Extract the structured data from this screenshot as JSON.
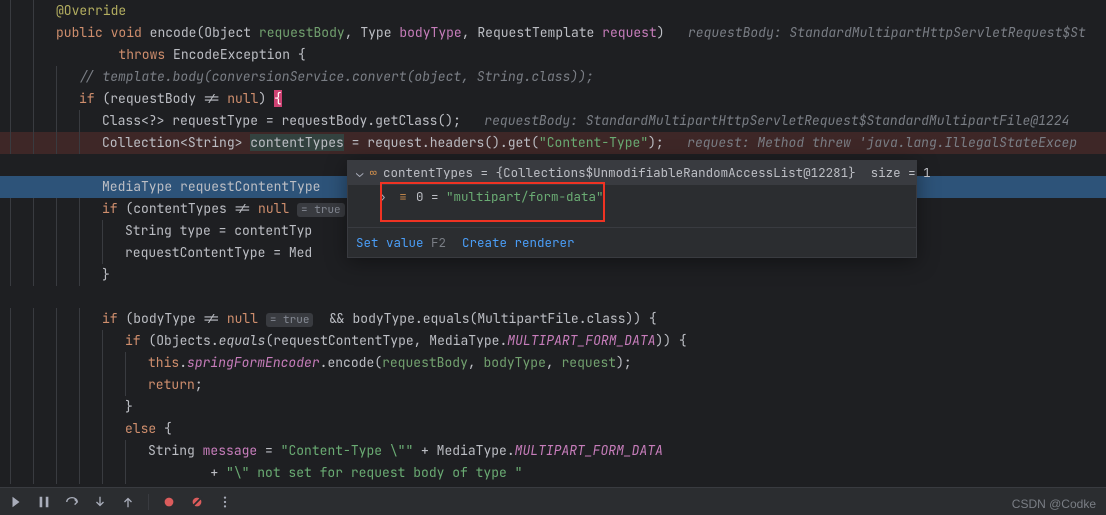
{
  "code": {
    "override": "@Override",
    "public": "public",
    "void": "void",
    "encode": "encode",
    "object_t": "Object",
    "requestBody": "requestBody",
    "type_t": "Type",
    "bodyType": "bodyType",
    "reqtemplate": "RequestTemplate",
    "request": "request",
    "inline1": "requestBody: StandardMultipartHttpServletRequest$St",
    "throws": "throws",
    "exc": "EncodeException",
    "cmt_line": "// template.body(conversionService.convert(object, String.class));",
    "if": "if",
    "null": "null",
    "class_kw": "Class",
    "wild": "<?>",
    "requestType": "requestType",
    "getClass": "getClass",
    "inline2": "requestBody: StandardMultipartHttpServletRequest$StandardMultipartFile@1224",
    "collection": "Collection",
    "string_t": "String",
    "contentTypes": "contentTypes",
    "headers": "headers",
    "get": "get",
    "ct_str": "\"Content-Type\"",
    "inline3": "request: Method threw 'java.lang.IllegalStateExcep",
    "mediatype": "MediaType",
    "requestContentType": "requestContentType",
    "hint_true": "= true",
    "type_v": "type",
    "contentTyp_trunc": "contentTyp",
    "med_trunc": "Med",
    "objects": "Objects",
    "equals": "equals",
    "multipartfile": "MultipartFile",
    "class_f": ".class",
    "mpfd": "MULTIPART_FORM_DATA",
    "this": "this",
    "sfe": "springFormEncoder",
    "return": "return",
    "else": "else",
    "message": "message",
    "ct_open": "\"Content-Type \\\"\"",
    "plus": " + ",
    "not_set": "\"\\\" not set for request body of type \""
  },
  "popup": {
    "var": "contentTypes",
    "eq": " = ",
    "val": "{Collections$UnmodifiableRandomAccessList@12281}  size = 1",
    "idx": "0",
    "idxval": "\"multipart/form-data\"",
    "setvalue": "Set value",
    "f2": "F2",
    "renderer": "Create renderer"
  },
  "watermark": "CSDN @Codke"
}
